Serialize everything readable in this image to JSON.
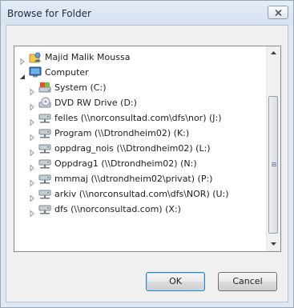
{
  "dialog": {
    "title": "Browse for Folder",
    "close_icon": "close-x-icon"
  },
  "tree": {
    "items": [
      {
        "label": "Majid Malik Moussa",
        "icon": "user-folder-icon",
        "depth": 0,
        "expander": "collapsed"
      },
      {
        "label": "Computer",
        "icon": "computer-icon",
        "depth": 0,
        "expander": "expanded"
      },
      {
        "label": "System (C:)",
        "icon": "system-drive-icon",
        "depth": 1,
        "expander": "collapsed"
      },
      {
        "label": "DVD RW Drive (D:)",
        "icon": "dvd-drive-icon",
        "depth": 1,
        "expander": "collapsed"
      },
      {
        "label": "felles (\\\\norconsultad.com\\dfs\\nor) (J:)",
        "icon": "network-drive-icon",
        "depth": 1,
        "expander": "collapsed"
      },
      {
        "label": "Program (\\\\Dtrondheim02) (K:)",
        "icon": "network-drive-icon",
        "depth": 1,
        "expander": "collapsed"
      },
      {
        "label": "oppdrag_nois (\\\\Dtrondheim02) (L:)",
        "icon": "network-drive-icon",
        "depth": 1,
        "expander": "collapsed"
      },
      {
        "label": "Oppdrag1 (\\\\Dtrondheim02) (N:)",
        "icon": "network-drive-icon",
        "depth": 1,
        "expander": "collapsed"
      },
      {
        "label": "mmmaj (\\\\dtrondheim02\\privat) (P:)",
        "icon": "network-drive-icon",
        "depth": 1,
        "expander": "collapsed"
      },
      {
        "label": "arkiv (\\\\norconsultad.com\\dfs\\NOR) (U:)",
        "icon": "network-drive-icon",
        "depth": 1,
        "expander": "collapsed"
      },
      {
        "label": "dfs (\\\\norconsultad.com) (X:)",
        "icon": "network-drive-icon",
        "depth": 1,
        "expander": "collapsed"
      }
    ]
  },
  "buttons": {
    "ok_label": "OK",
    "cancel_label": "Cancel"
  },
  "colors": {
    "window_frame": "#dfe8f3",
    "client_background": "#f0f0f0",
    "tree_background": "#ffffff"
  }
}
